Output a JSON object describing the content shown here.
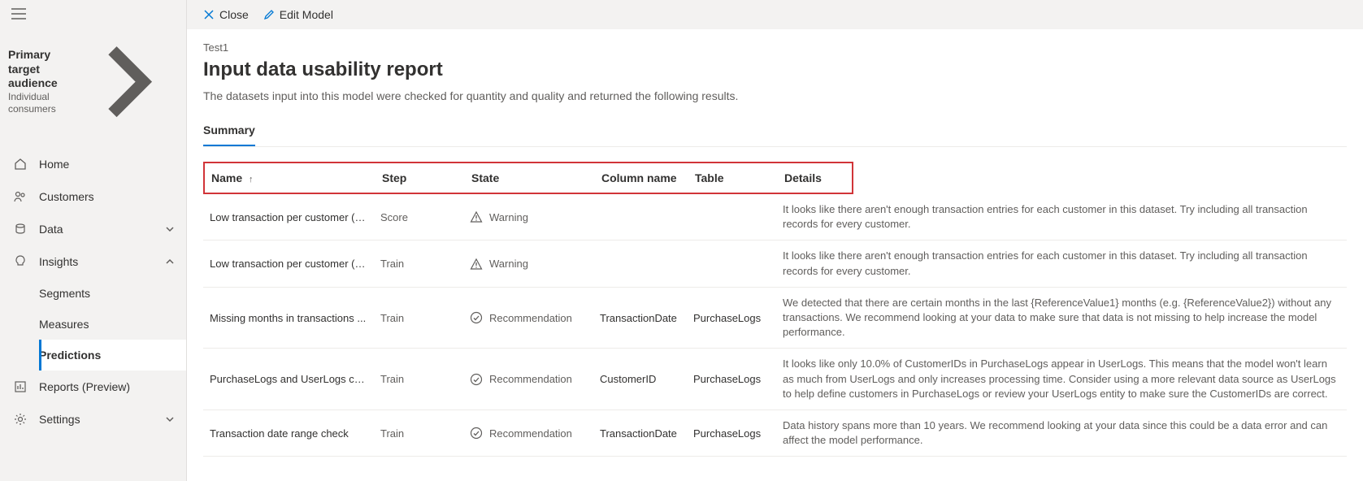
{
  "sidebar": {
    "audience_title": "Primary target audience",
    "audience_subtitle": "Individual consumers",
    "items": {
      "home": "Home",
      "customers": "Customers",
      "data": "Data",
      "insights": "Insights",
      "segments": "Segments",
      "measures": "Measures",
      "predictions": "Predictions",
      "reports": "Reports (Preview)",
      "settings": "Settings"
    }
  },
  "toolbar": {
    "close": "Close",
    "edit_model": "Edit Model"
  },
  "page": {
    "breadcrumb": "Test1",
    "title": "Input data usability report",
    "description": "The datasets input into this model were checked for quantity and quality and returned the following results.",
    "tab_summary": "Summary"
  },
  "table": {
    "headers": {
      "name": "Name",
      "step": "Step",
      "state": "State",
      "column_name": "Column name",
      "table": "Table",
      "details": "Details"
    },
    "sort_indicator": "↑",
    "rows": [
      {
        "name": "Low transaction per customer (s...",
        "step": "Score",
        "state_icon": "warning",
        "state": "Warning",
        "column_name": "",
        "table": "",
        "details": "It looks like there aren't enough transaction entries for each customer in this dataset. Try including all transaction records for every customer."
      },
      {
        "name": "Low transaction per customer (s...",
        "step": "Train",
        "state_icon": "warning",
        "state": "Warning",
        "column_name": "",
        "table": "",
        "details": "It looks like there aren't enough transaction entries for each customer in this dataset. Try including all transaction records for every customer."
      },
      {
        "name": "Missing months in transactions ...",
        "step": "Train",
        "state_icon": "recommendation",
        "state": "Recommendation",
        "column_name": "TransactionDate",
        "table": "PurchaseLogs",
        "details": "We detected that there are certain months in the last {ReferenceValue1} months (e.g. {ReferenceValue2}) without any transactions. We recommend looking at your data to make sure that data is not missing to help increase the model performance."
      },
      {
        "name": "PurchaseLogs and UserLogs cus...",
        "step": "Train",
        "state_icon": "recommendation",
        "state": "Recommendation",
        "column_name": "CustomerID",
        "table": "PurchaseLogs",
        "details": "It looks like only 10.0% of CustomerIDs in PurchaseLogs appear in UserLogs. This means that the model won't learn as much from UserLogs and only increases processing time. Consider using a more relevant data source as UserLogs to help define customers in PurchaseLogs or review your UserLogs entity to make sure the CustomerIDs are correct."
      },
      {
        "name": "Transaction date range check",
        "step": "Train",
        "state_icon": "recommendation",
        "state": "Recommendation",
        "column_name": "TransactionDate",
        "table": "PurchaseLogs",
        "details": "Data history spans more than 10 years. We recommend looking at your data since this could be a data error and can affect the model performance."
      }
    ]
  }
}
